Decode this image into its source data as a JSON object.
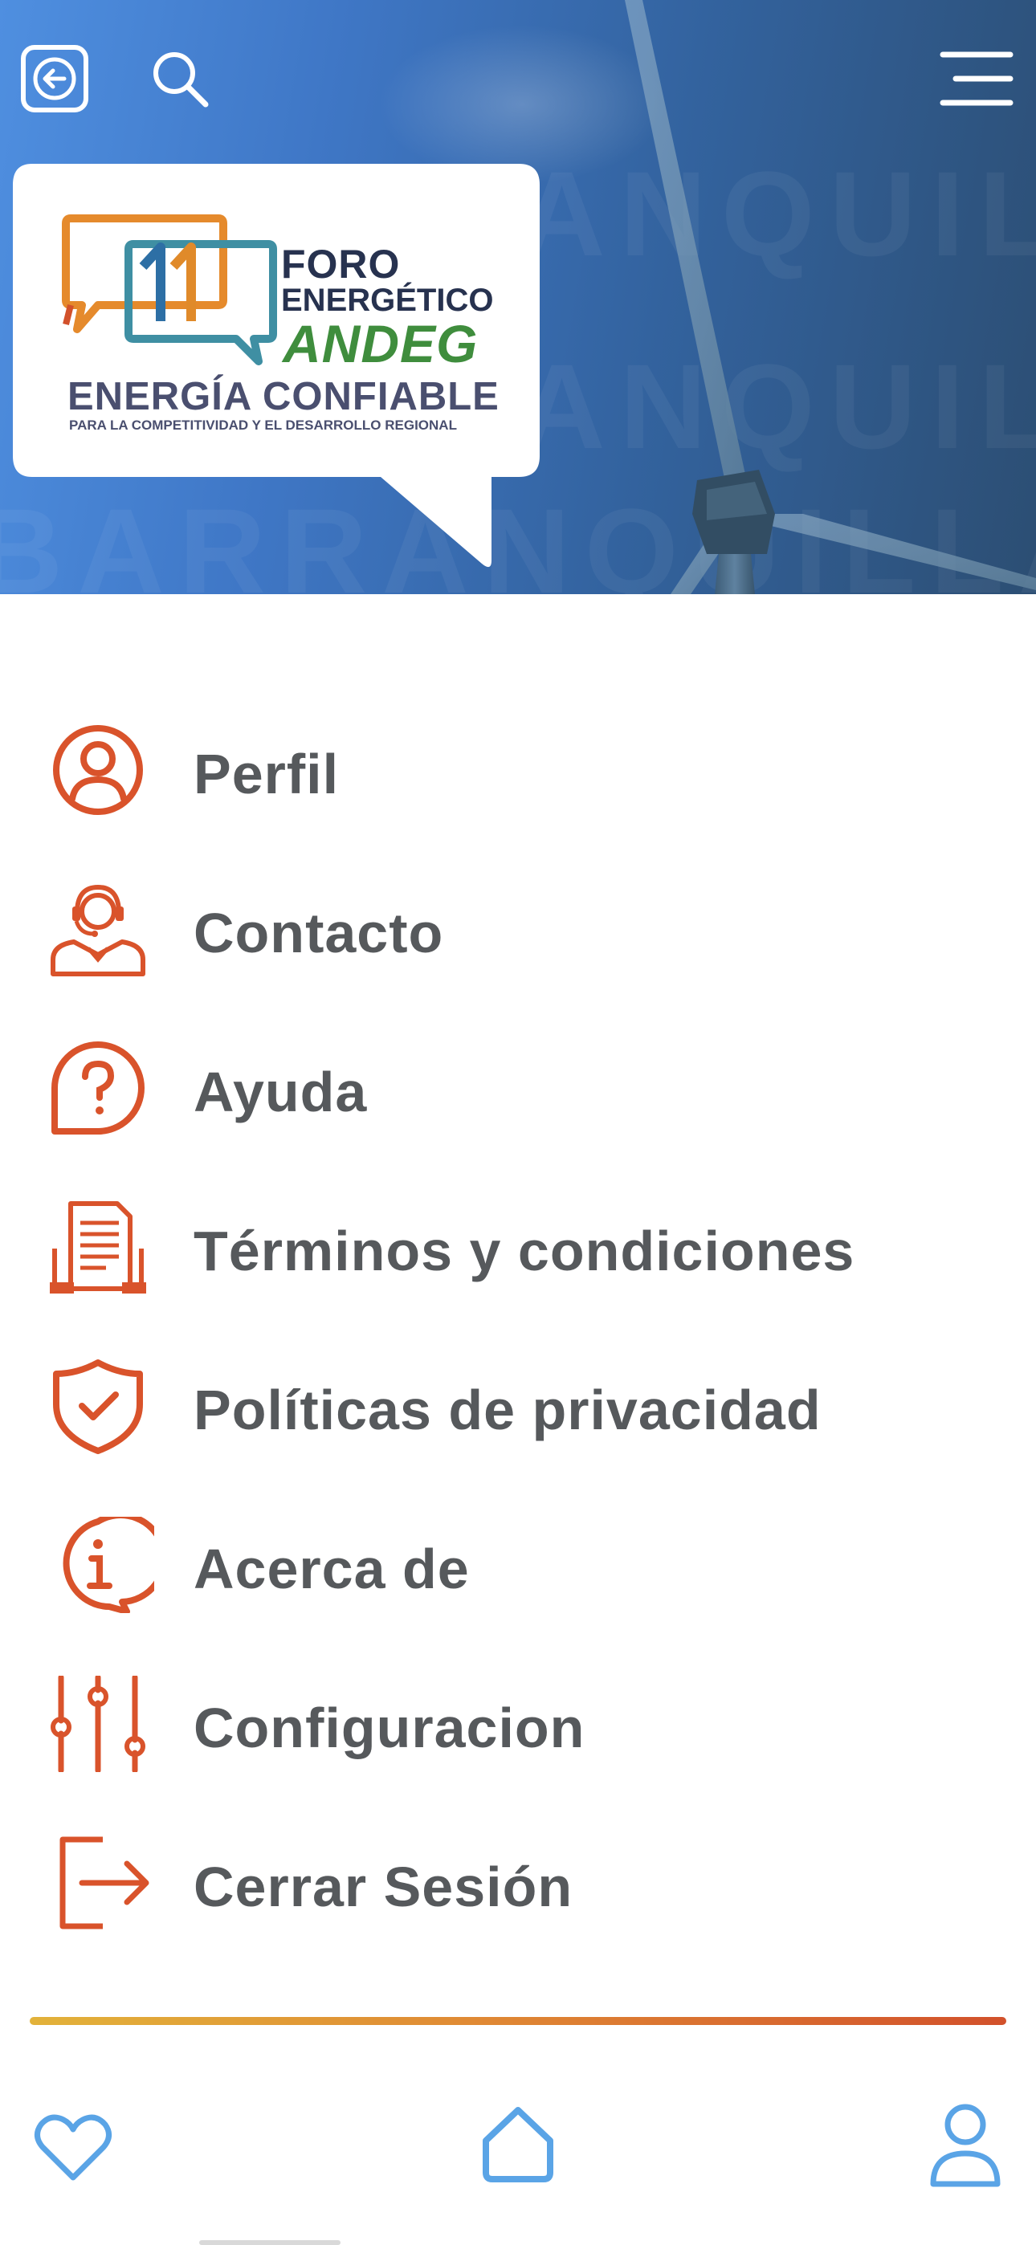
{
  "header": {
    "watermark_text": "BARRANQUILLA",
    "logo": {
      "line1": "FORO",
      "line2": "ENERGÉTICO",
      "line3": "ANDEG",
      "line4": "ENERGÍA CONFIABLE",
      "line5": "PARA LA COMPETITIVIDAD Y EL DESARROLLO REGIONAL"
    },
    "icons": {
      "back": "back-icon",
      "search": "search-icon",
      "menu": "hamburger-menu-icon"
    }
  },
  "menu": {
    "items": [
      {
        "label": "Perfil",
        "icon": "profile-icon"
      },
      {
        "label": "Contacto",
        "icon": "headset-agent-icon"
      },
      {
        "label": "Ayuda",
        "icon": "help-bubble-icon"
      },
      {
        "label": "Términos y condiciones",
        "icon": "document-terms-icon"
      },
      {
        "label": "Políticas de privacidad",
        "icon": "shield-check-icon"
      },
      {
        "label": "Acerca de",
        "icon": "info-bubble-icon"
      },
      {
        "label": "Configuracion",
        "icon": "sliders-icon"
      },
      {
        "label": "Cerrar Sesión",
        "icon": "logout-icon"
      }
    ]
  },
  "bottom_nav": {
    "items": [
      {
        "icon": "heart-icon"
      },
      {
        "icon": "home-icon"
      },
      {
        "icon": "user-icon"
      }
    ]
  },
  "colors": {
    "menu_icon": "#d9532b",
    "menu_text": "#56595c",
    "nav_icon": "#5aa4e6",
    "header_start": "#4f8fe0",
    "header_end": "#2c4e73",
    "divider_start": "#e2b23a",
    "divider_end": "#d2512b"
  }
}
